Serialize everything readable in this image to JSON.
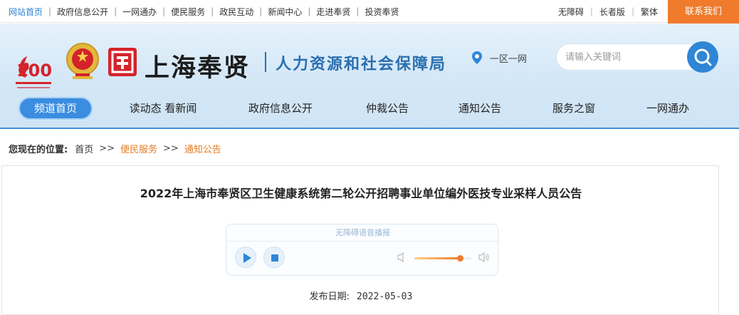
{
  "topbar": {
    "links": [
      "网站首页",
      "政府信息公开",
      "一网通办",
      "便民服务",
      "政民互动",
      "新闻中心",
      "走进奉贤",
      "投资奉贤"
    ],
    "accessibility": "无障碍",
    "elder": "长者版",
    "traditional": "繁体",
    "contact": "联系我们"
  },
  "header": {
    "city_name": "上海奉贤",
    "bureau_name": "人力资源和社会保障局",
    "district_link": "一区一网",
    "search_placeholder": "请输入关键词"
  },
  "nav": {
    "items": [
      "频道首页",
      "读动态 看新闻",
      "政府信息公开",
      "仲裁公告",
      "通知公告",
      "服务之窗",
      "一网通办"
    ],
    "active_index": 0
  },
  "breadcrumb": {
    "label": "您现在的位置:",
    "items": [
      "首页",
      "便民服务",
      "通知公告"
    ],
    "separator": ">>"
  },
  "article": {
    "title": "2022年上海市奉贤区卫生健康系统第二轮公开招聘事业单位编外医技专业采样人员公告",
    "player": {
      "title": "无障碍语音播报",
      "volume": 0.8
    },
    "date_label": "发布日期:",
    "date_value": "2022-05-03"
  },
  "colors": {
    "accent": "#2f86d6",
    "contact": "#f07b2c",
    "breadcrumb_highlight": "#e77b1f"
  }
}
